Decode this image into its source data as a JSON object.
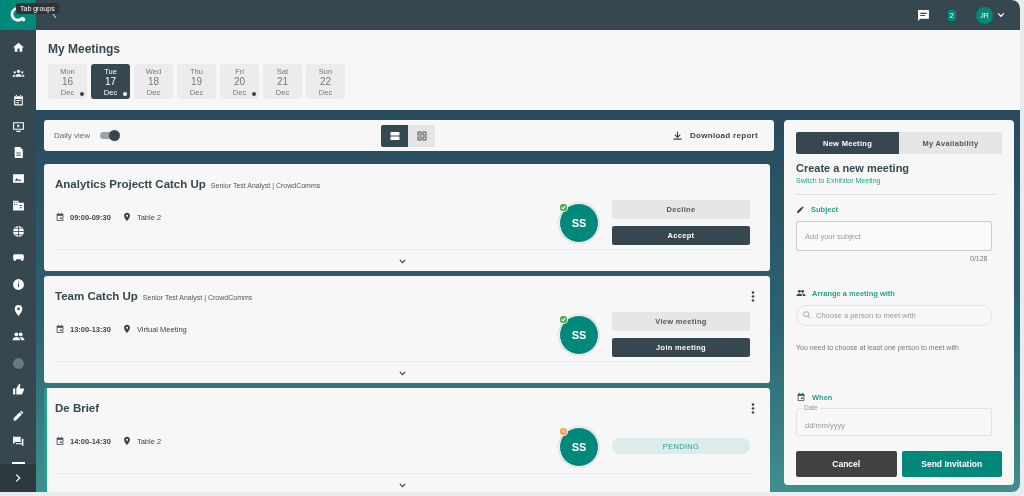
{
  "tooltip": "Tab groups",
  "top_bar": {
    "notification_count": "2",
    "avatar": "JR"
  },
  "page_title": "My Meetings",
  "days": [
    {
      "weekday": "Mon",
      "day": "16",
      "month": "Dec",
      "selected": false,
      "has_meetings": true
    },
    {
      "weekday": "Tue",
      "day": "17",
      "month": "Dec",
      "selected": true,
      "has_meetings": true
    },
    {
      "weekday": "Wed",
      "day": "18",
      "month": "Dec",
      "selected": false,
      "has_meetings": false
    },
    {
      "weekday": "Thu",
      "day": "19",
      "month": "Dec",
      "selected": false,
      "has_meetings": false
    },
    {
      "weekday": "Fri",
      "day": "20",
      "month": "Dec",
      "selected": false,
      "has_meetings": true
    },
    {
      "weekday": "Sat",
      "day": "21",
      "month": "Dec",
      "selected": false,
      "has_meetings": false
    },
    {
      "weekday": "Sun",
      "day": "22",
      "month": "Dec",
      "selected": false,
      "has_meetings": false
    }
  ],
  "toolbar": {
    "daily_view_label": "Daily view",
    "daily_view_on": true,
    "view_modes": [
      {
        "kind": "list",
        "selected": true
      },
      {
        "kind": "grid",
        "selected": false
      }
    ],
    "download": "Download report"
  },
  "meetings": [
    {
      "title": "Analytics Projectt Catch Up",
      "subtitle": "Senior Test Analyst | CrowdComms",
      "time": "09:00-09:30",
      "location": "Table 2",
      "avatar": "SS",
      "badge": {
        "kind": "accepted"
      },
      "has_menu": false,
      "highlighted": false,
      "actions": [
        {
          "label": "Decline",
          "kind": "secondary"
        },
        {
          "label": "Accept",
          "kind": "primary"
        }
      ]
    },
    {
      "title": "Team Catch Up",
      "subtitle": "Senior Test Analyst | CrowdComms",
      "time": "13:00-13:30",
      "location": "Virtual Meeting",
      "avatar": "SS",
      "badge": {
        "kind": "accepted"
      },
      "has_menu": true,
      "highlighted": false,
      "actions": [
        {
          "label": "View meeting",
          "kind": "secondary"
        },
        {
          "label": "Join meeting",
          "kind": "primary"
        }
      ]
    },
    {
      "title": "De Brief",
      "time": "14:00-14:30",
      "location": "Table 2",
      "avatar": "SS",
      "badge": {
        "kind": "pending"
      },
      "has_menu": true,
      "highlighted": true,
      "actions": [
        {
          "label": "PENDING",
          "kind": "status"
        }
      ]
    }
  ],
  "panel": {
    "tabs": [
      {
        "label": "New Meeting",
        "selected": true
      },
      {
        "label": "My Availability",
        "selected": false
      }
    ],
    "heading": "Create a new meeting",
    "switch_link": "Switch to Exhibitor Meeting",
    "subject_label": "Subject",
    "subject_placeholder": "Add your subject",
    "subject_counter": "0/128",
    "arrange_label": "Arrange a meeting with",
    "person_placeholder": "Choose a person to meet with",
    "hint": "You need to choose at least one person to meet with",
    "when_label": "When",
    "date_label": "Date",
    "date_placeholder": "dd/mm/yyyy",
    "cancel": "Cancel",
    "send": "Send Invitation"
  }
}
